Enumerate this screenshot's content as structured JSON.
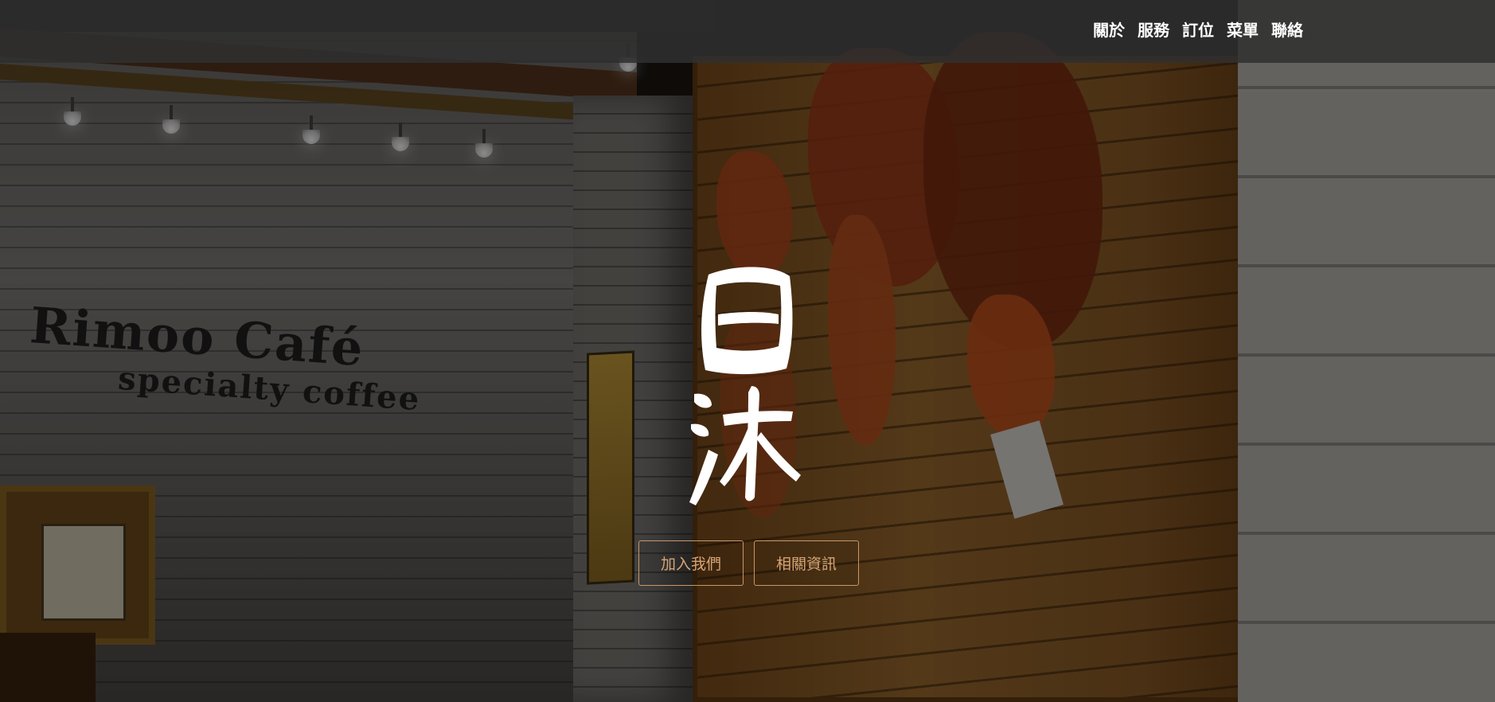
{
  "nav": {
    "links": [
      {
        "label": "關於"
      },
      {
        "label": "服務"
      },
      {
        "label": "訂位"
      },
      {
        "label": "菜單"
      },
      {
        "label": "聯絡"
      }
    ]
  },
  "background": {
    "sign_title": "Rimoo Café",
    "sign_subtitle": "specialty coffee"
  },
  "hero": {
    "logo_text": "日沐",
    "buttons": [
      {
        "label": "加入我們",
        "icon": "none"
      },
      {
        "label": "相關資訊",
        "icon": "none"
      }
    ]
  },
  "colors": {
    "navbar": "#303030",
    "nav_text": "#ffffff",
    "button_accent": "#c99668",
    "logo": "#ffffff"
  }
}
